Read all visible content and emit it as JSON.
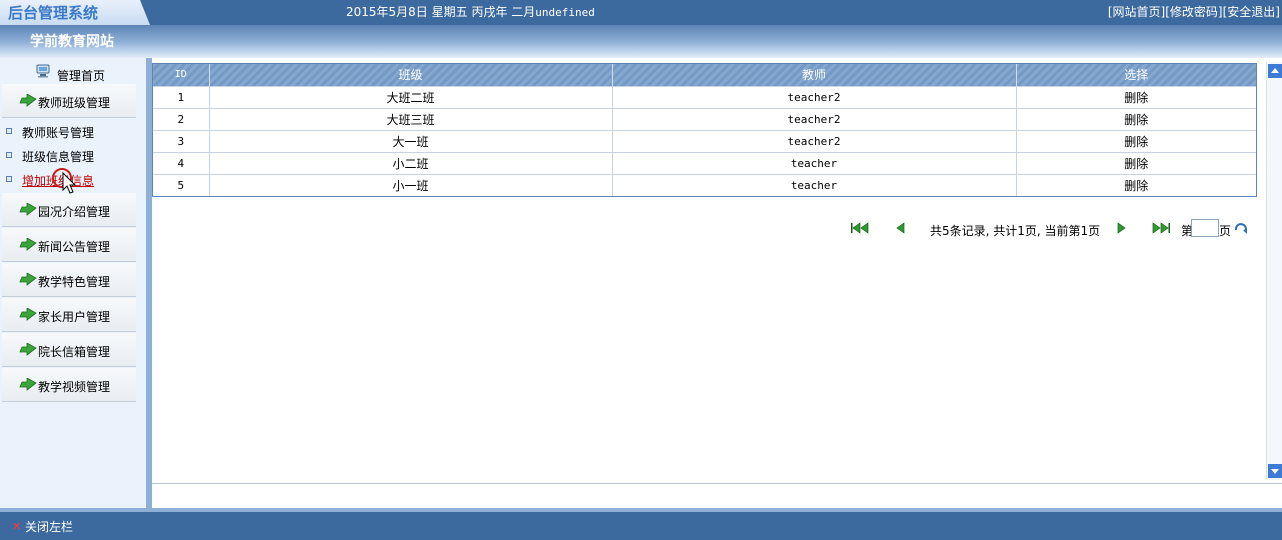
{
  "header": {
    "logo_text": "后台管理系统",
    "date_text": "2015年5月8日 星期五 丙戌年 二月",
    "date_suffix": "undefined",
    "links": [
      "[网站首页]",
      "[修改密码]",
      "[安全退出]"
    ]
  },
  "site_band": {
    "title": "学前教育网站"
  },
  "sidebar": {
    "home_label": "管理首页",
    "groups": [
      {
        "label": "教师班级管理"
      },
      {
        "label": "园况介绍管理"
      },
      {
        "label": "新闻公告管理"
      },
      {
        "label": "教学特色管理"
      },
      {
        "label": "家长用户管理"
      },
      {
        "label": "院长信箱管理"
      },
      {
        "label": "教学视频管理"
      }
    ],
    "sub_items": [
      {
        "label": "教师账号管理",
        "active": false
      },
      {
        "label": "班级信息管理",
        "active": false
      },
      {
        "label": "增加班级信息",
        "active": true
      }
    ]
  },
  "table": {
    "columns": [
      "ID",
      "班级",
      "教师",
      "选择"
    ],
    "rows": [
      {
        "id": "1",
        "class": "大班二班",
        "teacher": "teacher2",
        "action": "删除"
      },
      {
        "id": "2",
        "class": "大班三班",
        "teacher": "teacher2",
        "action": "删除"
      },
      {
        "id": "3",
        "class": "大一班",
        "teacher": "teacher2",
        "action": "删除"
      },
      {
        "id": "4",
        "class": "小二班",
        "teacher": "teacher",
        "action": "删除"
      },
      {
        "id": "5",
        "class": "小一班",
        "teacher": "teacher",
        "action": "删除"
      }
    ]
  },
  "pager": {
    "summary": "共5条记录, 共计1页, 当前第1页",
    "page_prefix": "第",
    "page_suffix": "页",
    "page_value": ""
  },
  "footer": {
    "close_label": "关闭左栏"
  },
  "colors": {
    "header_bg": "#3d6a9e",
    "table_header": "#7fa2cb",
    "active_link": "#c00000"
  }
}
